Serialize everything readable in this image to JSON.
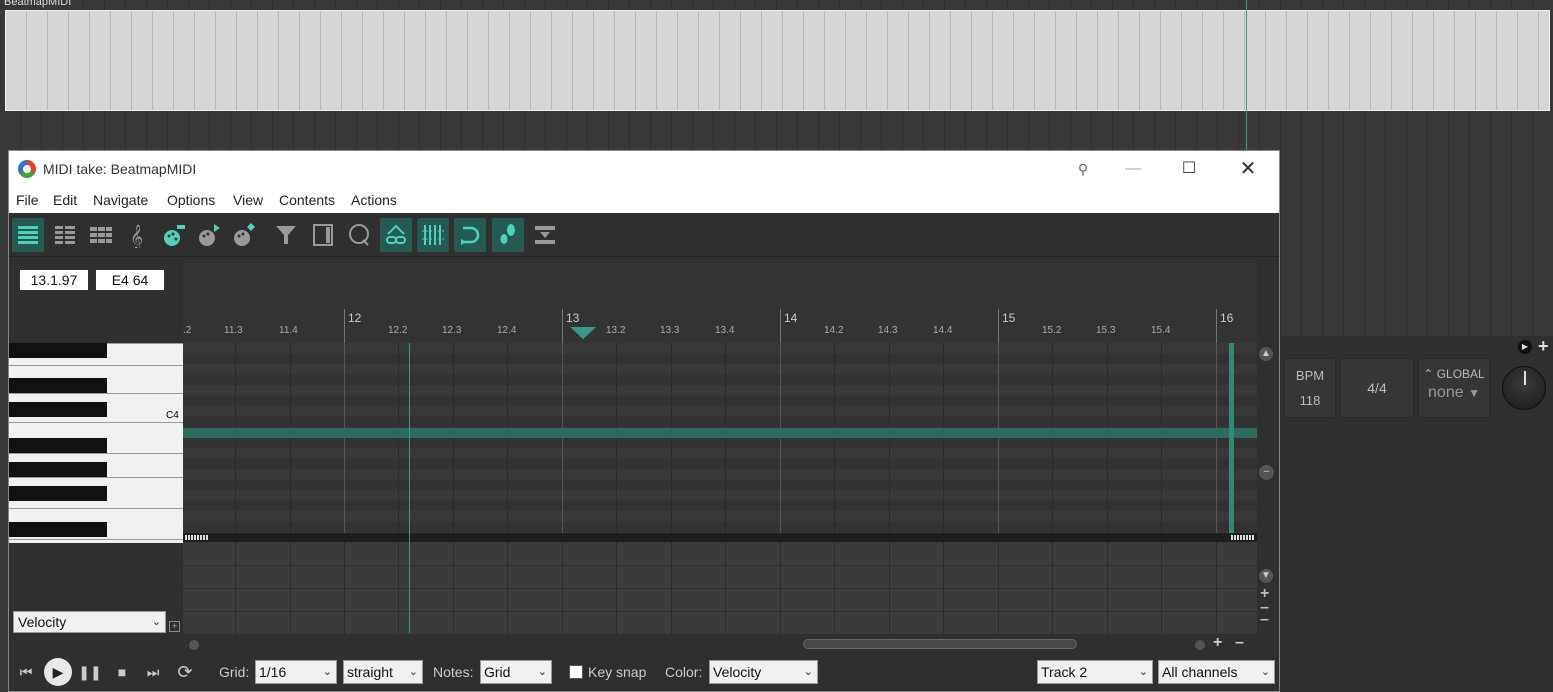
{
  "arrange": {
    "item_name": "BeatmapMIDI",
    "bpm_label": "BPM",
    "bpm_value": "118",
    "time_signature": "4/4",
    "global_label": "GLOBAL",
    "global_value": "none"
  },
  "window": {
    "title": "MIDI take: BeatmapMIDI",
    "controls": {
      "pin": "pin-icon",
      "minimize": "minimize-icon",
      "maximize": "maximize-icon",
      "close": "close-icon"
    }
  },
  "menu": [
    "File",
    "Edit",
    "Navigate",
    "Options",
    "View",
    "Contents",
    "Actions"
  ],
  "toolbar": {
    "buttons": [
      "piano-roll-view-icon",
      "named-notes-view-icon",
      "event-list-view-icon",
      "notation-view-icon",
      "insert-note-icon",
      "step-input-icon",
      "insert-event-icon",
      "filter-icon",
      "note-properties-icon",
      "quantize-icon",
      "link-edit-cursor-icon",
      "grid-icon",
      "loop-icon",
      "step-record-icon",
      "import-icon"
    ]
  },
  "fields": {
    "position": "13.1.97",
    "pitch": "E4  64"
  },
  "keyboard": {
    "c4_label": "C4"
  },
  "ruler": {
    "major": [
      "12",
      "13",
      "14",
      "15",
      "16"
    ],
    "minor": [
      ".2",
      "11.3",
      "11.4",
      "12.2",
      "12.3",
      "12.4",
      "13.2",
      "13.3",
      "13.4",
      "14.2",
      "14.3",
      "14.4",
      "15.2",
      "15.3",
      "15.4"
    ]
  },
  "cc_lane": {
    "selected": "Velocity"
  },
  "bottombar": {
    "grid_label": "Grid:",
    "grid_value": "1/16",
    "grid_type": "straight",
    "notes_label": "Notes:",
    "notes_value": "Grid",
    "keysnap_label": "Key snap",
    "color_label": "Color:",
    "color_value": "Velocity",
    "track_value": "Track 2",
    "channel_value": "All channels"
  },
  "colors": {
    "accent": "#3a9a8a",
    "note": "#2e6a60",
    "active_button": "#245a52"
  }
}
